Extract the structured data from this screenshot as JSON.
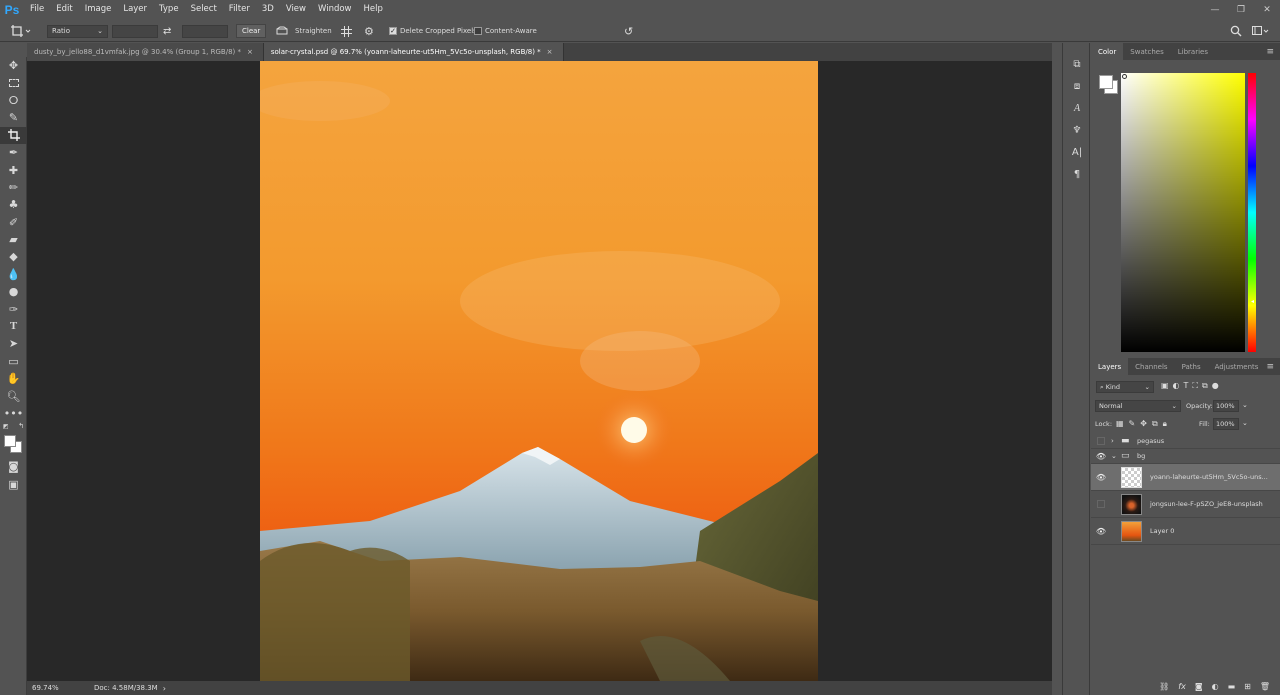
{
  "app": {
    "logo": "Ps"
  },
  "menu": [
    "File",
    "Edit",
    "Image",
    "Layer",
    "Type",
    "Select",
    "Filter",
    "3D",
    "View",
    "Window",
    "Help"
  ],
  "options": {
    "ratio": "Ratio",
    "clear": "Clear",
    "straighten": "Straighten",
    "delete_cropped": "Delete Cropped Pixels",
    "content_aware": "Content-Aware"
  },
  "tabs": [
    {
      "label": "dusty_by_jello88_d1vmfak.jpg @ 30.4% (Group 1, RGB/8) *",
      "close": "×"
    },
    {
      "label": "solar-crystal.psd @ 69.7% (yoann-laheurte-ut5Hm_5Vc5o-unsplash, RGB/8) *",
      "close": "×"
    }
  ],
  "status": {
    "zoom": "69.74%",
    "doc": "Doc: 4.58M/38.3M"
  },
  "color_panel": {
    "tabs": [
      "Color",
      "Swatches",
      "Libraries"
    ]
  },
  "layers_panel": {
    "tabs": [
      "Layers",
      "Channels",
      "Paths",
      "Adjustments"
    ],
    "kind": "Kind",
    "blend": "Normal",
    "opacity_label": "Opacity:",
    "opacity": "100%",
    "lock_label": "Lock:",
    "fill_label": "Fill:",
    "fill": "100%",
    "layers": [
      {
        "name": "pegasus",
        "visible": false
      },
      {
        "name": "bg",
        "visible": true
      },
      {
        "name": "yoann-laheurte-ut5Hm_5Vc5o-uns...",
        "visible": true
      },
      {
        "name": "jongsun-lee-F-pSZO_jeE8-unsplash",
        "visible": false
      },
      {
        "name": "Layer 0",
        "visible": true
      }
    ],
    "footer_fx": "fx"
  },
  "colors": {
    "accent": "#31a8ff",
    "panel": "#535353",
    "canvas_bg": "#282828"
  }
}
